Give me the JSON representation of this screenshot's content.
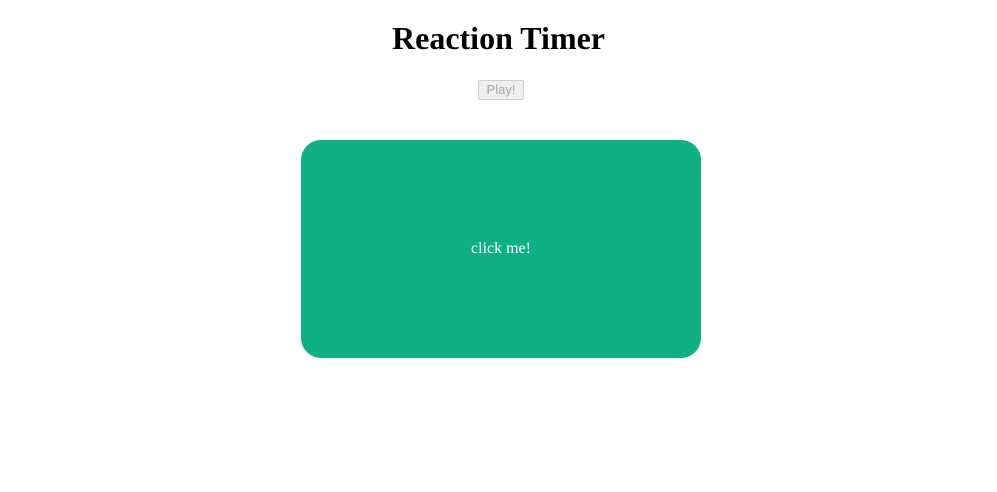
{
  "header": {
    "title": "Reaction Timer"
  },
  "controls": {
    "play_label": "Play!",
    "play_disabled": true
  },
  "block": {
    "label": "click me!",
    "color": "#10b087"
  },
  "colors": {
    "background": "#ffffff",
    "title": "#000000",
    "block_text": "#ffffff"
  }
}
